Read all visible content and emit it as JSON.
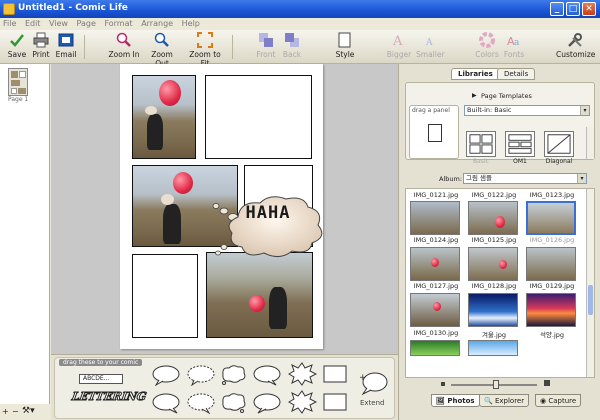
{
  "window": {
    "title": "Untitled1 - Comic Life"
  },
  "menu": [
    "File",
    "Edit",
    "View",
    "Page",
    "Format",
    "Arrange",
    "Help"
  ],
  "toolbar": {
    "save": "Save",
    "print": "Print",
    "email": "Email",
    "zoom_in": "Zoom In",
    "zoom_out": "Zoom Out",
    "zoom_fit": "Zoom to Fit",
    "front": "Front",
    "back": "Back",
    "style": "Style",
    "bigger": "Bigger",
    "smaller": "Smaller",
    "colors": "Colors",
    "fonts": "Fonts",
    "customize": "Customize"
  },
  "pages": {
    "label": "Page 1"
  },
  "comic": {
    "caption_text": "HAHA"
  },
  "stickers": {
    "hint": "drag these to your comic",
    "sample_text": "ABCDE...",
    "lettering": "LETTERING",
    "extend": "Extend"
  },
  "right": {
    "tab_libraries": "Libraries",
    "tab_details": "Details",
    "page_templates": "Page Templates",
    "drag_panel": "drag a panel",
    "builtin": "Built-in: Basic",
    "templates": [
      "Basic",
      "OM1",
      "Diagonal"
    ],
    "album_label": "Album:",
    "album_value": "그림 샘플",
    "thumbs": [
      "IMG_0121.jpg",
      "IMG_0122.jpg",
      "IMG_0123.jpg",
      "IMG_0124.jpg",
      "IMG_0125.jpg",
      "IMG_0126.jpg",
      "IMG_0127.jpg",
      "IMG_0128.jpg",
      "IMG_0129.jpg",
      "IMG_0130.jpg",
      "겨울.jpg",
      "석양.jpg"
    ],
    "bottom_tabs": [
      "Photos",
      "Explorer",
      "Capture"
    ]
  }
}
